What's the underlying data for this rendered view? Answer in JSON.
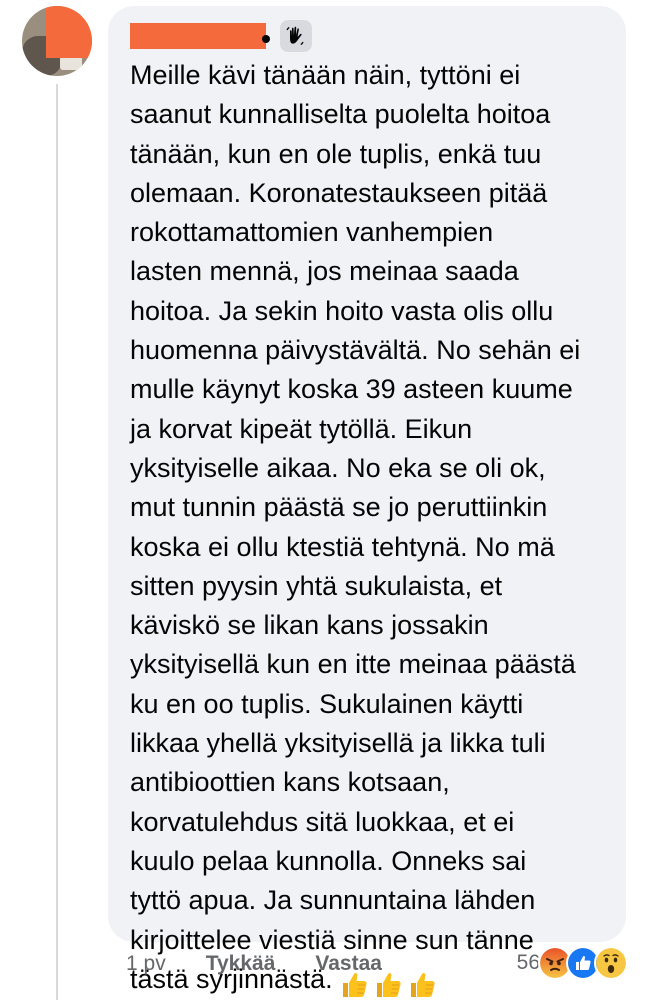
{
  "comment": {
    "author_name": "",
    "badge_icon": "waving-hand-icon",
    "text": "Meille kävi tänään näin, tyttöni ei\nsaanut kunnalliselta puolelta hoitoa\ntänään, kun en ole tuplis, enkä tuu\nolemaan. Koronatestaukseen pitää\nrokottamattomien vanhempien\nlasten mennä, jos meinaa saada\nhoitoa. Ja sekin hoito vasta olis ollu\nhuomenna päivystävältä. No sehän ei\nmulle käynyt koska 39 asteen kuume\nja korvat kipeät tytöllä. Eikun\nyksityiselle aikaa. No eka se oli ok,\nmut tunnin päästä se jo peruttiinkin\nkoska ei ollu ktestiä tehtynä. No mä\nsitten pyysin yhtä sukulaista, et\nkäviskö se likan kans jossakin\nyksityisellä kun en itte meinaa päästä\nku en oo tuplis. Sukulainen käytti\nlikkaa yhellä yksityisellä ja likka tuli\nantibioottien kans kotsaan,\nkorvatulehdus sitä luokkaa, et ei\nkuulo pelaa kunnolla. Onneks sai\ntyttö apua. Ja sunnuntaina lähden\nkirjoittelee viestiä sinne sun tänne\ntästä syrjinnästä.",
    "trailing_emoji": [
      "thumbs-up-icon",
      "thumbs-up-icon",
      "thumbs-up-icon"
    ]
  },
  "footer": {
    "time": "1 pv",
    "like_label": "Tykkää",
    "reply_label": "Vastaa"
  },
  "reactions": {
    "count": "56",
    "icons": [
      "angry-icon",
      "like-icon",
      "wow-icon"
    ]
  },
  "colors": {
    "bubble": "#f0f2f5",
    "meta_text": "#65676b",
    "redaction": "#f46a3c",
    "like_blue": "#1877f2"
  }
}
